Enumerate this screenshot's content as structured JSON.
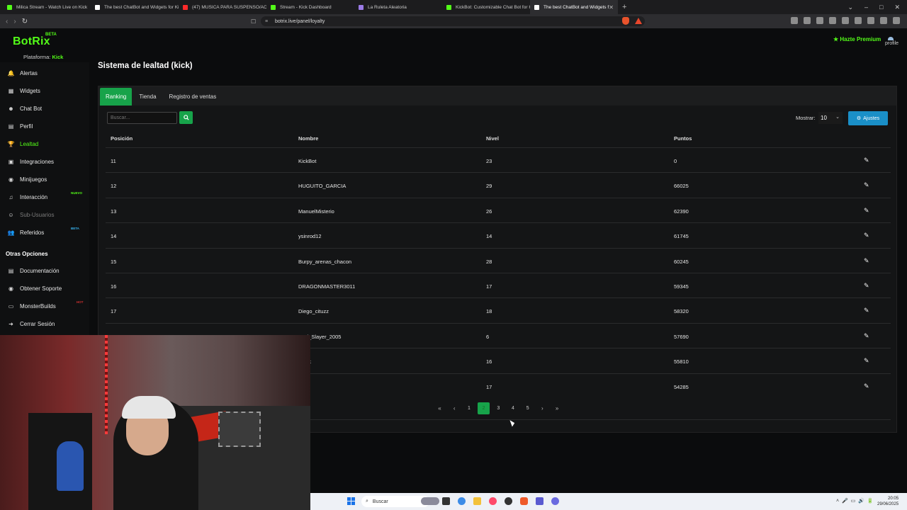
{
  "browser": {
    "tabs": [
      {
        "label": "Milica Stream - Watch Live on Kick",
        "color": "#53fc18"
      },
      {
        "label": "The best ChatBot and Widgets for Ki",
        "color": "#ffffff"
      },
      {
        "label": "(47) MUSICA PARA SUSPENSO/ACCI",
        "color": "#ff2a2a"
      },
      {
        "label": "Stream - Kick Dashboard",
        "color": "#53fc18"
      },
      {
        "label": "La Ruleta Aleatoria",
        "color": "#9b7be6"
      },
      {
        "label": "KickBot: Customizable Chat Bot for Ki",
        "color": "#53fc18"
      },
      {
        "label": "The best ChatBot and Widgets f",
        "color": "#ffffff"
      }
    ],
    "active_tab": 6,
    "new_tab": "+",
    "url": "botrix.live/panel/loyalty"
  },
  "header": {
    "logo": "BotRix",
    "beta": "BETA",
    "platform_label": "Plataforma:",
    "platform_value": "Kick",
    "premium": "Hazte Premium",
    "profile": "profile"
  },
  "sidebar": {
    "items": [
      {
        "label": "Alertas",
        "icon": "bell-icon",
        "glyph": "🔔"
      },
      {
        "label": "Widgets",
        "icon": "widgets-icon",
        "glyph": "▦"
      },
      {
        "label": "Chat Bot",
        "icon": "robot-icon",
        "glyph": "☻"
      },
      {
        "label": "Perfil",
        "icon": "profile-card-icon",
        "glyph": "▤"
      },
      {
        "label": "Lealtad",
        "icon": "trophy-icon",
        "glyph": "🏆"
      },
      {
        "label": "Integraciones",
        "icon": "integrations-icon",
        "glyph": "▣"
      },
      {
        "label": "Minijuegos",
        "icon": "gamepad-icon",
        "glyph": "◉"
      },
      {
        "label": "Interacción",
        "icon": "music-icon",
        "glyph": "♫",
        "badge": "NUEVO"
      },
      {
        "label": "Sub-Usuarios",
        "icon": "users-icon",
        "glyph": "☺"
      },
      {
        "label": "Referidos",
        "icon": "referrals-icon",
        "glyph": "👥",
        "badge": "BETA"
      }
    ],
    "other_title": "Otras Opciones",
    "other": [
      {
        "label": "Documentación",
        "icon": "docs-icon",
        "glyph": "▤"
      },
      {
        "label": "Obtener Soporte",
        "icon": "support-icon",
        "glyph": "◉"
      },
      {
        "label": "MonsterBuilds",
        "icon": "monitor-icon",
        "glyph": "▭",
        "badge": "HOT"
      },
      {
        "label": "Cerrar Sesión",
        "icon": "logout-icon",
        "glyph": "➜"
      }
    ]
  },
  "page": {
    "title": "Sistema de lealtad (kick)",
    "tabs": [
      "Ranking",
      "Tienda",
      "Registro de ventas"
    ],
    "search_placeholder": "Buscar...",
    "show_label": "Mostrar:",
    "show_value": "10",
    "settings_label": "Ajustes"
  },
  "table": {
    "headers": [
      "Posición",
      "Nombre",
      "Nivel",
      "Puntos"
    ],
    "rows": [
      {
        "pos": "11",
        "name": "KickBot",
        "level": "23",
        "points": "0"
      },
      {
        "pos": "12",
        "name": "HUGUITO_GARCIA",
        "level": "29",
        "points": "66025"
      },
      {
        "pos": "13",
        "name": "ManuelMisterio",
        "level": "26",
        "points": "62390"
      },
      {
        "pos": "14",
        "name": "ysinrod12",
        "level": "14",
        "points": "61745"
      },
      {
        "pos": "15",
        "name": "Burpy_arenas_chacon",
        "level": "28",
        "points": "60245"
      },
      {
        "pos": "16",
        "name": "DRAGONMASTER3011",
        "level": "17",
        "points": "59345"
      },
      {
        "pos": "17",
        "name": "Diego_cituzz",
        "level": "18",
        "points": "58320"
      },
      {
        "pos": "18",
        "name": "God_Slayer_2005",
        "level": "6",
        "points": "57690"
      },
      {
        "pos": "",
        "name": "...ack",
        "level": "16",
        "points": "55810"
      },
      {
        "pos": "",
        "name": "...x",
        "level": "17",
        "points": "54285"
      }
    ]
  },
  "pagination": {
    "first": "«",
    "prev": "‹",
    "pages": [
      "1",
      "2",
      "3",
      "4",
      "5"
    ],
    "current": 1,
    "next": "›",
    "last": "»"
  },
  "taskbar": {
    "search": "Buscar",
    "time": "20:05",
    "date": "29/06/2025"
  }
}
